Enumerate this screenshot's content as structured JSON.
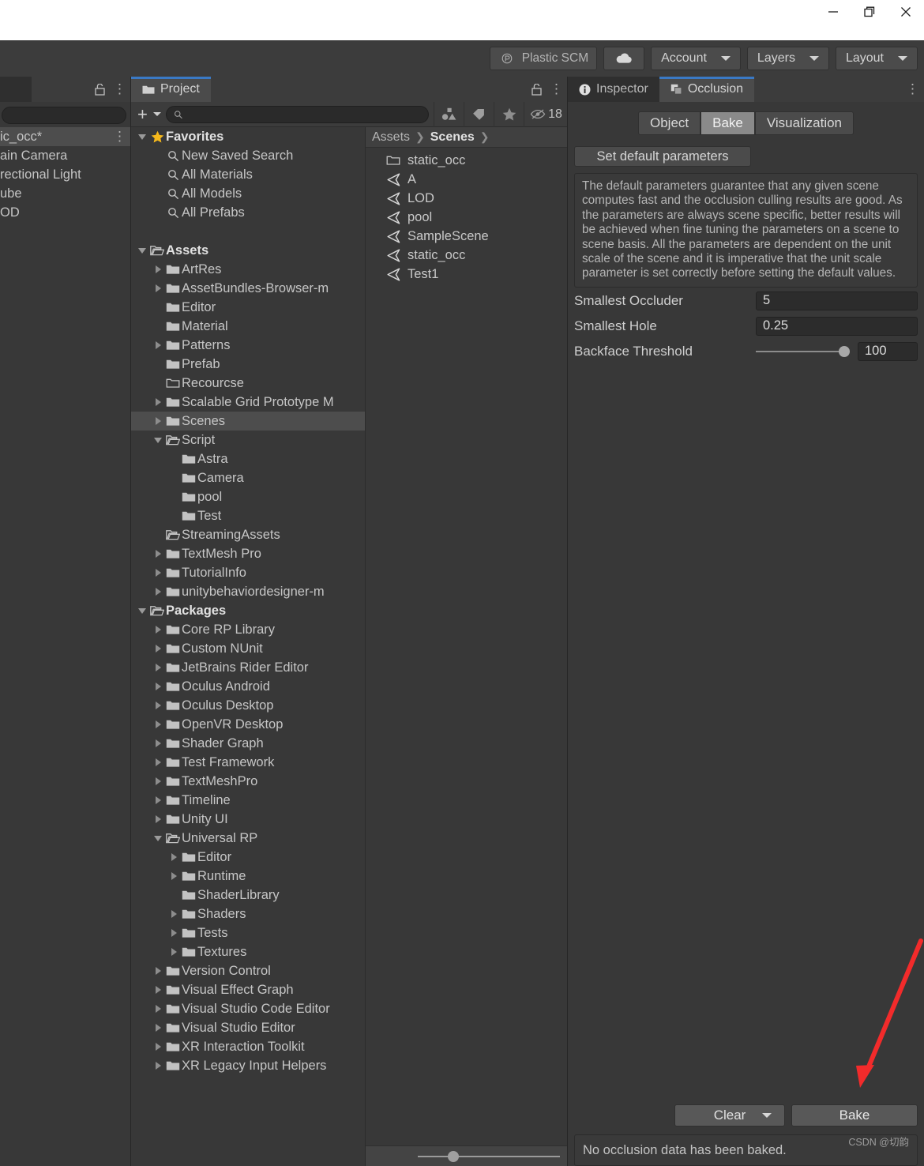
{
  "window": {
    "controls": [
      {
        "name": "minimize",
        "glyph": "—"
      },
      {
        "name": "restore",
        "glyph": "❐"
      },
      {
        "name": "close",
        "glyph": "✕"
      }
    ]
  },
  "toolbar": {
    "plastic_scm_label": "Plastic SCM",
    "cloud_label": "",
    "account_label": "Account",
    "layers_label": "Layers",
    "layout_label": "Layout"
  },
  "hierarchy": {
    "tab_label": "",
    "search_value": "",
    "rows": [
      {
        "label": "ic_occ*",
        "selected": true
      },
      {
        "label": "ain Camera",
        "selected": false
      },
      {
        "label": "rectional Light",
        "selected": false
      },
      {
        "label": "ube",
        "selected": false
      },
      {
        "label": "OD",
        "selected": false
      }
    ]
  },
  "project": {
    "tab_label": "Project",
    "create_label": "+",
    "search_placeholder": "",
    "search_value": "",
    "hidden_count": "18",
    "breadcrumb": {
      "root": "Assets",
      "current": "Scenes",
      "sep": "❯"
    },
    "files": [
      {
        "label": "static_occ",
        "icon": "folder-outline-icon"
      },
      {
        "label": "A",
        "icon": "unity-scene-icon"
      },
      {
        "label": "LOD",
        "icon": "unity-scene-icon"
      },
      {
        "label": "pool",
        "icon": "unity-scene-icon"
      },
      {
        "label": "SampleScene",
        "icon": "unity-scene-icon"
      },
      {
        "label": "static_occ",
        "icon": "unity-scene-icon"
      },
      {
        "label": "Test1",
        "icon": "unity-scene-icon"
      }
    ],
    "tree": [
      {
        "label": "Favorites",
        "depth": 0,
        "twisty": "down",
        "icon": "star-icon",
        "bold": true,
        "selected": false
      },
      {
        "label": "New Saved Search",
        "depth": 1,
        "twisty": "none",
        "icon": "search-icon",
        "bold": false,
        "selected": false
      },
      {
        "label": "All Materials",
        "depth": 1,
        "twisty": "none",
        "icon": "search-icon",
        "bold": false,
        "selected": false
      },
      {
        "label": "All Models",
        "depth": 1,
        "twisty": "none",
        "icon": "search-icon",
        "bold": false,
        "selected": false
      },
      {
        "label": "All Prefabs",
        "depth": 1,
        "twisty": "none",
        "icon": "search-icon",
        "bold": false,
        "selected": false
      },
      {
        "label": "",
        "depth": 0,
        "twisty": "none",
        "icon": "none",
        "bold": false,
        "selected": false
      },
      {
        "label": "Assets",
        "depth": 0,
        "twisty": "down",
        "icon": "folder-open-icon",
        "bold": true,
        "selected": false
      },
      {
        "label": "ArtRes",
        "depth": 1,
        "twisty": "right",
        "icon": "folder-icon",
        "bold": false,
        "selected": false
      },
      {
        "label": "AssetBundles-Browser-m",
        "depth": 1,
        "twisty": "right",
        "icon": "folder-icon",
        "bold": false,
        "selected": false
      },
      {
        "label": "Editor",
        "depth": 1,
        "twisty": "none",
        "icon": "folder-icon",
        "bold": false,
        "selected": false
      },
      {
        "label": "Material",
        "depth": 1,
        "twisty": "none",
        "icon": "folder-icon",
        "bold": false,
        "selected": false
      },
      {
        "label": "Patterns",
        "depth": 1,
        "twisty": "right",
        "icon": "folder-icon",
        "bold": false,
        "selected": false
      },
      {
        "label": "Prefab",
        "depth": 1,
        "twisty": "none",
        "icon": "folder-icon",
        "bold": false,
        "selected": false
      },
      {
        "label": "Recourcse",
        "depth": 1,
        "twisty": "none",
        "icon": "folder-outline-icon",
        "bold": false,
        "selected": false
      },
      {
        "label": "Scalable Grid Prototype M",
        "depth": 1,
        "twisty": "right",
        "icon": "folder-icon",
        "bold": false,
        "selected": false
      },
      {
        "label": "Scenes",
        "depth": 1,
        "twisty": "right",
        "icon": "folder-icon",
        "bold": false,
        "selected": true
      },
      {
        "label": "Script",
        "depth": 1,
        "twisty": "down",
        "icon": "folder-open-icon",
        "bold": false,
        "selected": false
      },
      {
        "label": "Astra",
        "depth": 2,
        "twisty": "none",
        "icon": "folder-icon",
        "bold": false,
        "selected": false
      },
      {
        "label": "Camera",
        "depth": 2,
        "twisty": "none",
        "icon": "folder-icon",
        "bold": false,
        "selected": false
      },
      {
        "label": "pool",
        "depth": 2,
        "twisty": "none",
        "icon": "folder-icon",
        "bold": false,
        "selected": false
      },
      {
        "label": "Test",
        "depth": 2,
        "twisty": "none",
        "icon": "folder-icon",
        "bold": false,
        "selected": false
      },
      {
        "label": "StreamingAssets",
        "depth": 1,
        "twisty": "none",
        "icon": "folder-open-icon",
        "bold": false,
        "selected": false
      },
      {
        "label": "TextMesh Pro",
        "depth": 1,
        "twisty": "right",
        "icon": "folder-icon",
        "bold": false,
        "selected": false
      },
      {
        "label": "TutorialInfo",
        "depth": 1,
        "twisty": "right",
        "icon": "folder-icon",
        "bold": false,
        "selected": false
      },
      {
        "label": "unitybehaviordesigner-m",
        "depth": 1,
        "twisty": "right",
        "icon": "folder-icon",
        "bold": false,
        "selected": false
      },
      {
        "label": "Packages",
        "depth": 0,
        "twisty": "down",
        "icon": "folder-open-icon",
        "bold": true,
        "selected": false
      },
      {
        "label": "Core RP Library",
        "depth": 1,
        "twisty": "right",
        "icon": "folder-icon",
        "bold": false,
        "selected": false
      },
      {
        "label": "Custom NUnit",
        "depth": 1,
        "twisty": "right",
        "icon": "folder-icon",
        "bold": false,
        "selected": false
      },
      {
        "label": "JetBrains Rider Editor",
        "depth": 1,
        "twisty": "right",
        "icon": "folder-icon",
        "bold": false,
        "selected": false
      },
      {
        "label": "Oculus Android",
        "depth": 1,
        "twisty": "right",
        "icon": "folder-icon",
        "bold": false,
        "selected": false
      },
      {
        "label": "Oculus Desktop",
        "depth": 1,
        "twisty": "right",
        "icon": "folder-icon",
        "bold": false,
        "selected": false
      },
      {
        "label": "OpenVR Desktop",
        "depth": 1,
        "twisty": "right",
        "icon": "folder-icon",
        "bold": false,
        "selected": false
      },
      {
        "label": "Shader Graph",
        "depth": 1,
        "twisty": "right",
        "icon": "folder-icon",
        "bold": false,
        "selected": false
      },
      {
        "label": "Test Framework",
        "depth": 1,
        "twisty": "right",
        "icon": "folder-icon",
        "bold": false,
        "selected": false
      },
      {
        "label": "TextMeshPro",
        "depth": 1,
        "twisty": "right",
        "icon": "folder-icon",
        "bold": false,
        "selected": false
      },
      {
        "label": "Timeline",
        "depth": 1,
        "twisty": "right",
        "icon": "folder-icon",
        "bold": false,
        "selected": false
      },
      {
        "label": "Unity UI",
        "depth": 1,
        "twisty": "right",
        "icon": "folder-icon",
        "bold": false,
        "selected": false
      },
      {
        "label": "Universal RP",
        "depth": 1,
        "twisty": "down",
        "icon": "folder-open-icon",
        "bold": false,
        "selected": false
      },
      {
        "label": "Editor",
        "depth": 2,
        "twisty": "right",
        "icon": "folder-icon",
        "bold": false,
        "selected": false
      },
      {
        "label": "Runtime",
        "depth": 2,
        "twisty": "right",
        "icon": "folder-icon",
        "bold": false,
        "selected": false
      },
      {
        "label": "ShaderLibrary",
        "depth": 2,
        "twisty": "none",
        "icon": "folder-icon",
        "bold": false,
        "selected": false
      },
      {
        "label": "Shaders",
        "depth": 2,
        "twisty": "right",
        "icon": "folder-icon",
        "bold": false,
        "selected": false
      },
      {
        "label": "Tests",
        "depth": 2,
        "twisty": "right",
        "icon": "folder-icon",
        "bold": false,
        "selected": false
      },
      {
        "label": "Textures",
        "depth": 2,
        "twisty": "right",
        "icon": "folder-icon",
        "bold": false,
        "selected": false
      },
      {
        "label": "Version Control",
        "depth": 1,
        "twisty": "right",
        "icon": "folder-icon",
        "bold": false,
        "selected": false
      },
      {
        "label": "Visual Effect Graph",
        "depth": 1,
        "twisty": "right",
        "icon": "folder-icon",
        "bold": false,
        "selected": false
      },
      {
        "label": "Visual Studio Code Editor",
        "depth": 1,
        "twisty": "right",
        "icon": "folder-icon",
        "bold": false,
        "selected": false
      },
      {
        "label": "Visual Studio Editor",
        "depth": 1,
        "twisty": "right",
        "icon": "folder-icon",
        "bold": false,
        "selected": false
      },
      {
        "label": "XR Interaction Toolkit",
        "depth": 1,
        "twisty": "right",
        "icon": "folder-icon",
        "bold": false,
        "selected": false
      },
      {
        "label": "XR Legacy Input Helpers",
        "depth": 1,
        "twisty": "right",
        "icon": "folder-icon",
        "bold": false,
        "selected": false
      }
    ]
  },
  "inspector": {
    "tabs": [
      {
        "label": "Inspector",
        "active": false,
        "icon": "info-icon"
      },
      {
        "label": "Occlusion",
        "active": true,
        "icon": "occlusion-icon"
      }
    ]
  },
  "occlusion": {
    "segments": [
      {
        "label": "Object",
        "selected": false
      },
      {
        "label": "Bake",
        "selected": true
      },
      {
        "label": "Visualization",
        "selected": false
      }
    ],
    "set_defaults_label": "Set default parameters",
    "info_text": "The default parameters guarantee that any given scene computes fast and the occlusion culling results are good. As the parameters are always scene specific, better results will be achieved when fine tuning the parameters on a scene to scene basis. All the parameters are dependent on the unit scale of the scene and it is imperative that the unit scale parameter is set correctly before setting the default values.",
    "properties": [
      {
        "label": "Smallest Occluder",
        "value": "5"
      },
      {
        "label": "Smallest Hole",
        "value": "0.25"
      },
      {
        "label": "Backface Threshold",
        "value": "100"
      }
    ],
    "clear_label": "Clear",
    "bake_label": "Bake",
    "status_text": "No occlusion data has been baked.",
    "watermark": "CSDN @切韵",
    "accent_color": "#3a79c5",
    "arrow_color": "#f22b2b"
  }
}
